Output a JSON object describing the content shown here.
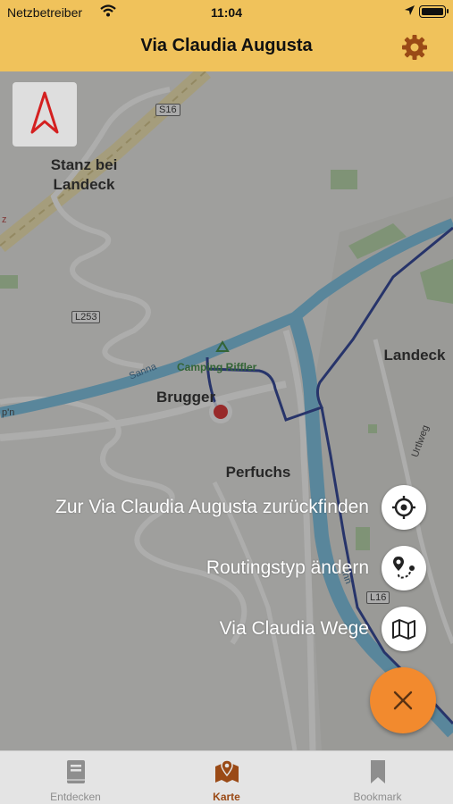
{
  "status_bar": {
    "carrier": "Netzbetreiber",
    "time": "11:04"
  },
  "nav": {
    "title": "Via Claudia Augusta",
    "settings_icon": "gear-icon"
  },
  "map": {
    "places": {
      "stanz": "Stanz bei\nLandeck",
      "landeck": "Landeck",
      "brugger": "Brugger",
      "perfuchs": "Perfuchs",
      "camping": "Camping Riffler",
      "urtlweg": "Urtlweg",
      "sanna": "Sanna",
      "inn": "Inn",
      "edge_label": "p'n",
      "edge_z": "z"
    },
    "road_tags": {
      "s16_top": "S16",
      "l253": "L253",
      "l16": "L16"
    }
  },
  "compass": {
    "icon": "north-arrow-icon"
  },
  "fab_menu": {
    "items": [
      {
        "label": "Zur Via Claudia Augusta zurückfinden",
        "icon": "crosshair-icon"
      },
      {
        "label": "Routingstyp ändern",
        "icon": "route-icon"
      },
      {
        "label": "Via Claudia Wege",
        "icon": "map-icon"
      }
    ],
    "close_icon": "close-icon"
  },
  "tabs": [
    {
      "label": "Entdecken",
      "icon": "book-icon",
      "active": false
    },
    {
      "label": "Karte",
      "icon": "map-pin-icon",
      "active": true
    },
    {
      "label": "Bookmark",
      "icon": "bookmark-icon",
      "active": false
    }
  ],
  "colors": {
    "header": "#f0c25b",
    "fab": "#f28a2e",
    "active_tab": "#9a4a16",
    "route": "#1a2f86",
    "river": "#6bb3d6"
  }
}
